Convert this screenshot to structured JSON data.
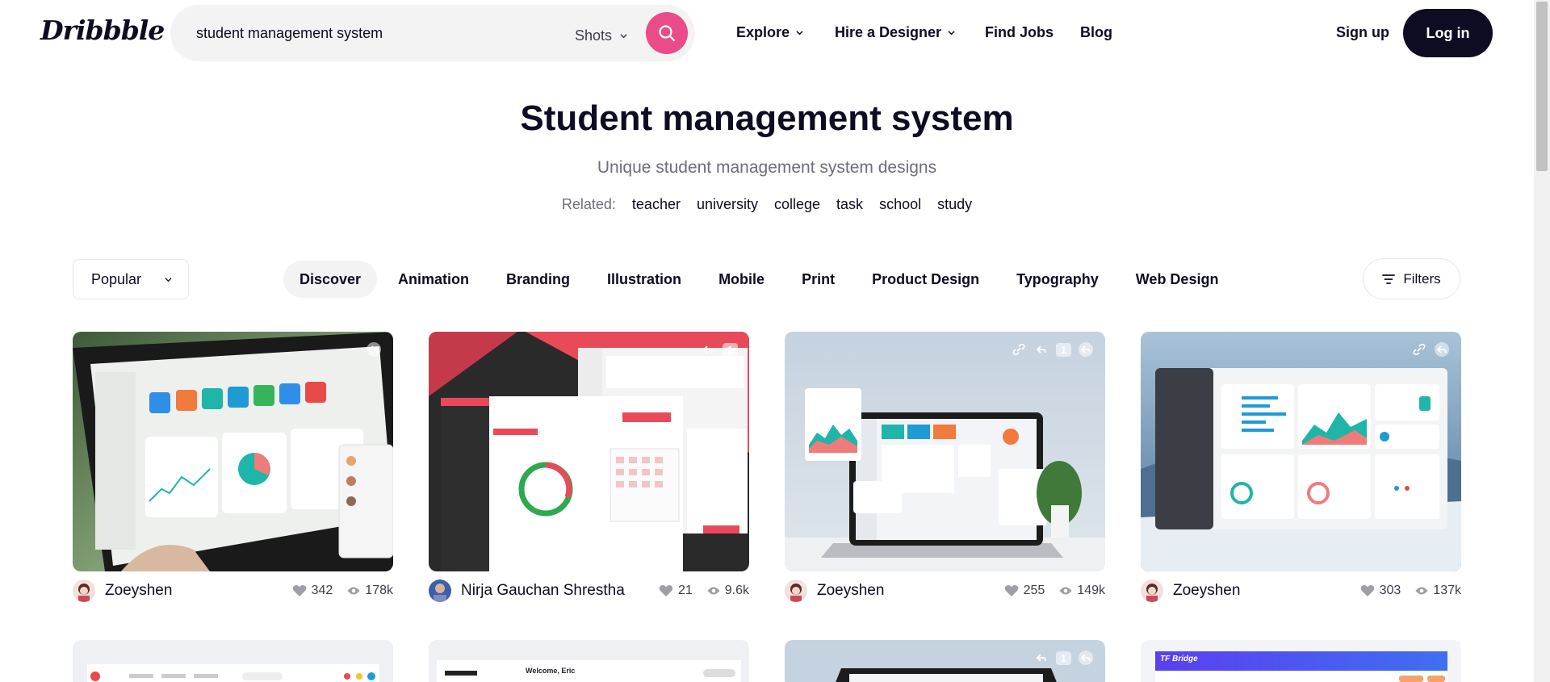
{
  "brand": {
    "logo_text": "Dribbble"
  },
  "search": {
    "value": "student management system",
    "type_label": "Shots"
  },
  "nav": {
    "explore": "Explore",
    "hire": "Hire a Designer",
    "jobs": "Find Jobs",
    "blog": "Blog",
    "signup": "Sign up",
    "login": "Log in"
  },
  "hero": {
    "title": "Student management system",
    "subtitle": "Unique student management system designs",
    "related_label": "Related:",
    "related": [
      "teacher",
      "university",
      "college",
      "task",
      "school",
      "study"
    ]
  },
  "filters": {
    "sort": "Popular",
    "categories": [
      "Discover",
      "Animation",
      "Branding",
      "Illustration",
      "Mobile",
      "Print",
      "Product Design",
      "Typography",
      "Web Design"
    ],
    "active_category": "Discover",
    "filters_label": "Filters"
  },
  "shots": [
    {
      "author": "Zoeyshen",
      "likes": "342",
      "views": "178k",
      "theme": "#6d8a5f"
    },
    {
      "author": "Nirja Gauchan Shrestha",
      "likes": "21",
      "views": "9.6k",
      "theme": "#e84a5a",
      "badge": "1"
    },
    {
      "author": "Zoeyshen",
      "likes": "255",
      "views": "149k",
      "theme": "#c9d6e3",
      "badge": "1"
    },
    {
      "author": "Zoeyshen",
      "likes": "303",
      "views": "137k",
      "theme": "#8fb0cc"
    }
  ],
  "row2": [
    {
      "label": ""
    },
    {
      "label": "Welcome, Eric"
    },
    {
      "label": "",
      "badge": "1"
    },
    {
      "label": "TF Bridge"
    }
  ],
  "colors": {
    "accent": "#ea4c89",
    "dark": "#0d0c22",
    "muted": "#6e6d7a"
  }
}
